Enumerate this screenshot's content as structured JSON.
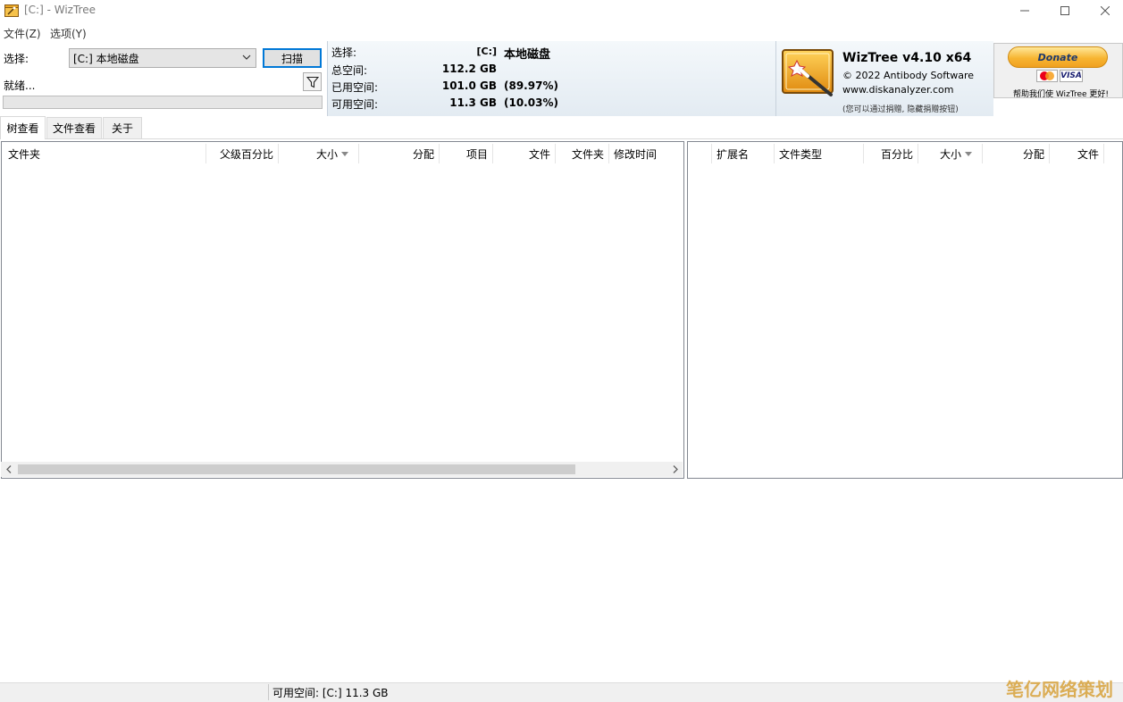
{
  "window": {
    "title": "[C:]  - WizTree"
  },
  "menu": {
    "items": [
      "文件(Z)",
      "选项(Y)"
    ]
  },
  "controls": {
    "select_label": "选择:",
    "drive_value": "[C:] 本地磁盘",
    "scan_label": "扫描",
    "status_text": "就绪...",
    "progress": 0
  },
  "info": {
    "select_label": "选择:",
    "select_drive": "[C:]",
    "select_name": "本地磁盘",
    "total_label": "总空间:",
    "total_value": "112.2 GB",
    "used_label": "已用空间:",
    "used_value": "101.0 GB",
    "used_pct": "(89.97%)",
    "free_label": "可用空间:",
    "free_value": "11.3 GB",
    "free_pct": "(10.03%)"
  },
  "brand": {
    "title": "WizTree v4.10 x64",
    "copyright": "© 2022 Antibody Software",
    "url": "www.diskanalyzer.com",
    "note": "(您可以通过捐赠, 隐藏捐赠按钮)"
  },
  "donate": {
    "button": "Donate",
    "card_visa": "VISA",
    "note": "帮助我们使 WizTree 更好!"
  },
  "tabs": [
    "树查看",
    "文件查看",
    "关于"
  ],
  "left_columns": [
    "文件夹",
    "父级百分比",
    "大小",
    "分配",
    "项目",
    "文件",
    "文件夹",
    "修改时间"
  ],
  "right_columns": [
    "扩展名",
    "文件类型",
    "百分比",
    "大小",
    "分配",
    "文件"
  ],
  "statusbar": {
    "free_text": "可用空间: [C:] 11.3 GB"
  },
  "watermark": "笔亿网络策划",
  "colors": {
    "accent": "#0078d7",
    "panel_gradient_top": "#f4f8fb",
    "panel_gradient_bottom": "#e3ebf2",
    "donate": "#f7b532"
  }
}
